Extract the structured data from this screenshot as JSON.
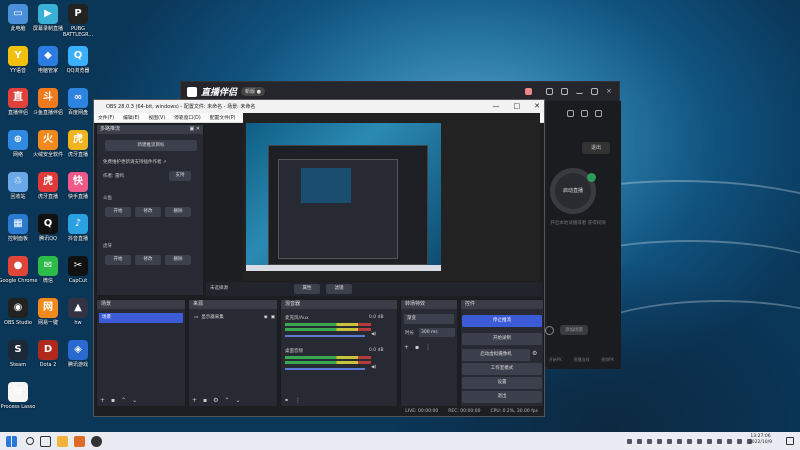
{
  "desktop_icons": [
    {
      "label": "此电脑",
      "color": "#4a90d9",
      "glyph": "▭"
    },
    {
      "label": "屏幕录制直播",
      "color": "#3bb0d6",
      "glyph": "▶"
    },
    {
      "label": "PUBG BATTLEGR...",
      "color": "#222",
      "glyph": "P"
    },
    {
      "label": "YY语音",
      "color": "#f2c10e",
      "glyph": "Y"
    },
    {
      "label": "电脑管家",
      "color": "#2b7be0",
      "glyph": "◆"
    },
    {
      "label": "QQ浏览器",
      "color": "#3ab0ff",
      "glyph": "Q"
    },
    {
      "label": "直播伴侣",
      "color": "#e0423b",
      "glyph": "直"
    },
    {
      "label": "斗鱼直播伴侣",
      "color": "#f07a1e",
      "glyph": "斗"
    },
    {
      "label": "百度网盘",
      "color": "#2d84e0",
      "glyph": "∞"
    },
    {
      "label": "网络",
      "color": "#2f8ae0",
      "glyph": "⊕"
    },
    {
      "label": "火绒安全软件",
      "color": "#f08a1c",
      "glyph": "火"
    },
    {
      "label": "虎牙直播",
      "color": "#f0b41c",
      "glyph": "虎"
    },
    {
      "label": "回收站",
      "color": "#6aa8e8",
      "glyph": "♲"
    },
    {
      "label": "虎牙直播",
      "color": "#e03a3a",
      "glyph": "虎"
    },
    {
      "label": "快手直播",
      "color": "#f05a8a",
      "glyph": "快"
    },
    {
      "label": "控制面板",
      "color": "#2a7ad0",
      "glyph": "▦"
    },
    {
      "label": "腾讯QQ",
      "color": "#111",
      "glyph": "Q"
    },
    {
      "label": "抖音直播",
      "color": "#2aa0e0",
      "glyph": "♪"
    },
    {
      "label": "Google Chrome",
      "color": "#e0453a",
      "glyph": "●"
    },
    {
      "label": "微信",
      "color": "#2dbb4a",
      "glyph": "✉"
    },
    {
      "label": "CapCut",
      "color": "#111",
      "glyph": "✂"
    },
    {
      "label": "OBS Studio",
      "color": "#222",
      "glyph": "◉"
    },
    {
      "label": "网易一键",
      "color": "#f08a1c",
      "glyph": "网"
    },
    {
      "label": "hw",
      "color": "#334",
      "glyph": "▲"
    },
    {
      "label": "Steam",
      "color": "#1b2838",
      "glyph": "S"
    },
    {
      "label": "Dota 2",
      "color": "#b0281e",
      "glyph": "D"
    },
    {
      "label": "腾讯游戏",
      "color": "#2a6ad0",
      "glyph": "◈"
    },
    {
      "label": "Process Lasso",
      "color": "#f5f5f5",
      "glyph": "▤"
    }
  ],
  "live_app": {
    "title": "直播伴侣",
    "version_badge": "新版 ●",
    "exit_label": "退出",
    "start_label": "启动直播",
    "note": "开启本地试播或者 获得权限",
    "bottom_button": "添加场景",
    "tabs": [
      "开始PK",
      "直播连线",
      "视频PK"
    ]
  },
  "obs": {
    "title": "OBS 28.0.3 (64-bit, windows) - 配置文件: 未命名 - 场景: 未命名",
    "menu": [
      "文件(F)",
      "编辑(E)",
      "视图(V)",
      "停靠窗口(D)",
      "配置文件(P)",
      "场景集合(S)",
      "工具(T)",
      "帮助(H)"
    ],
    "plugin_dock": {
      "title": "多路推流",
      "new_target_button": "新建推流目标",
      "supported_msg": "免费维护更新请支持插件作者 ↗",
      "author_label": "作者: 雷鸣",
      "support_button": "支持",
      "group1_label": "斗鱼",
      "group2_label": "虎牙",
      "start": "开始",
      "edit": "修改",
      "delete": "删除"
    },
    "preview_bar": {
      "no_source": "未选择源",
      "properties": "属性",
      "filters": "滤镜"
    },
    "scenes": {
      "title": "场景",
      "items": [
        "场景"
      ]
    },
    "sources": {
      "title": "来源",
      "items": [
        "显示器采集"
      ]
    },
    "mixer": {
      "title": "混音器",
      "channels": [
        {
          "name": "麦克风/Aux",
          "db": "0.0 dB"
        },
        {
          "name": "桌面音频",
          "db": "0.0 dB"
        }
      ]
    },
    "transitions": {
      "title": "转场特效",
      "type": "渐变",
      "duration_label": "时长",
      "duration_value": "300 ms"
    },
    "controls": {
      "title": "控件",
      "buttons": [
        "停止推流",
        "开始录制",
        "启动虚拟摄像机",
        "工作室模式",
        "设置",
        "退出"
      ]
    },
    "status": {
      "live": "LIVE: 00:00:00",
      "rec": "REC: 00:00:00",
      "cpu": "CPU: 0.2%, 30.00 fps"
    }
  },
  "taskbar": {
    "time": "13:27:06",
    "date": "2022/10/9"
  }
}
